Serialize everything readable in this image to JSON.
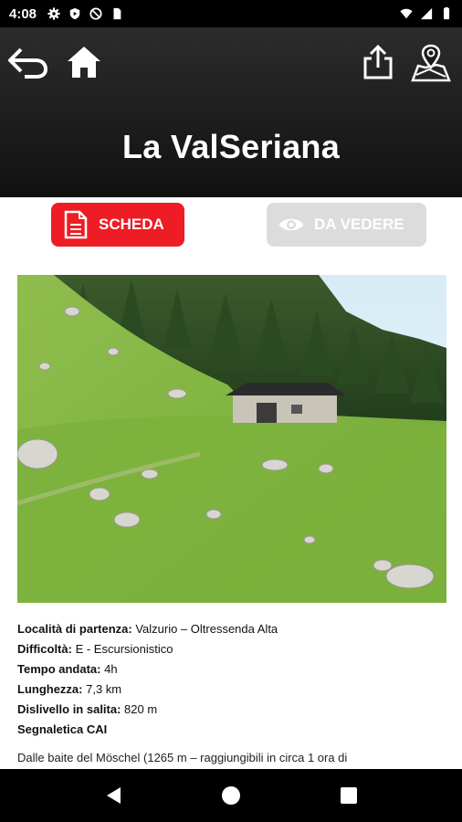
{
  "status_bar": {
    "time": "4:08",
    "icons_left": [
      "gear-icon",
      "play-protect-icon",
      "no-entry-icon",
      "sim-icon"
    ],
    "icons_right": [
      "wifi-icon",
      "signal-icon",
      "battery-icon"
    ]
  },
  "header": {
    "title": "La ValSeriana",
    "icons": [
      "back-arrow-icon",
      "home-icon",
      "share-icon",
      "map-pin-icon"
    ],
    "background": "#1a1a1a"
  },
  "tabs": [
    {
      "label": "SCHEDA",
      "icon": "document-icon",
      "color": "#ee1c24",
      "active": true
    },
    {
      "label": "DA VEDERE",
      "icon": "eye-icon",
      "color": "#dcdcdc",
      "active": false
    }
  ],
  "details": {
    "partenza_label": "Località di partenza:",
    "partenza_value": " Valzurio – Oltressenda Alta",
    "difficolta_label": "Difficoltà:",
    "difficolta_value": " E - Escursionistico",
    "tempo_label": "Tempo andata:",
    "tempo_value": " 4h",
    "lunghezza_label": "Lunghezza:",
    "lunghezza_value": " 7,3 km",
    "dislivello_label": "Dislivello in salita:",
    "dislivello_value": " 820 m",
    "segnaletica_label": "Segnaletica CAI"
  },
  "description": "Dalle baite del Möschel (1265 m – raggiungibili in circa 1 ora di",
  "nav": {
    "icons": [
      "back-triangle-icon",
      "home-circle-icon",
      "recents-square-icon"
    ]
  }
}
